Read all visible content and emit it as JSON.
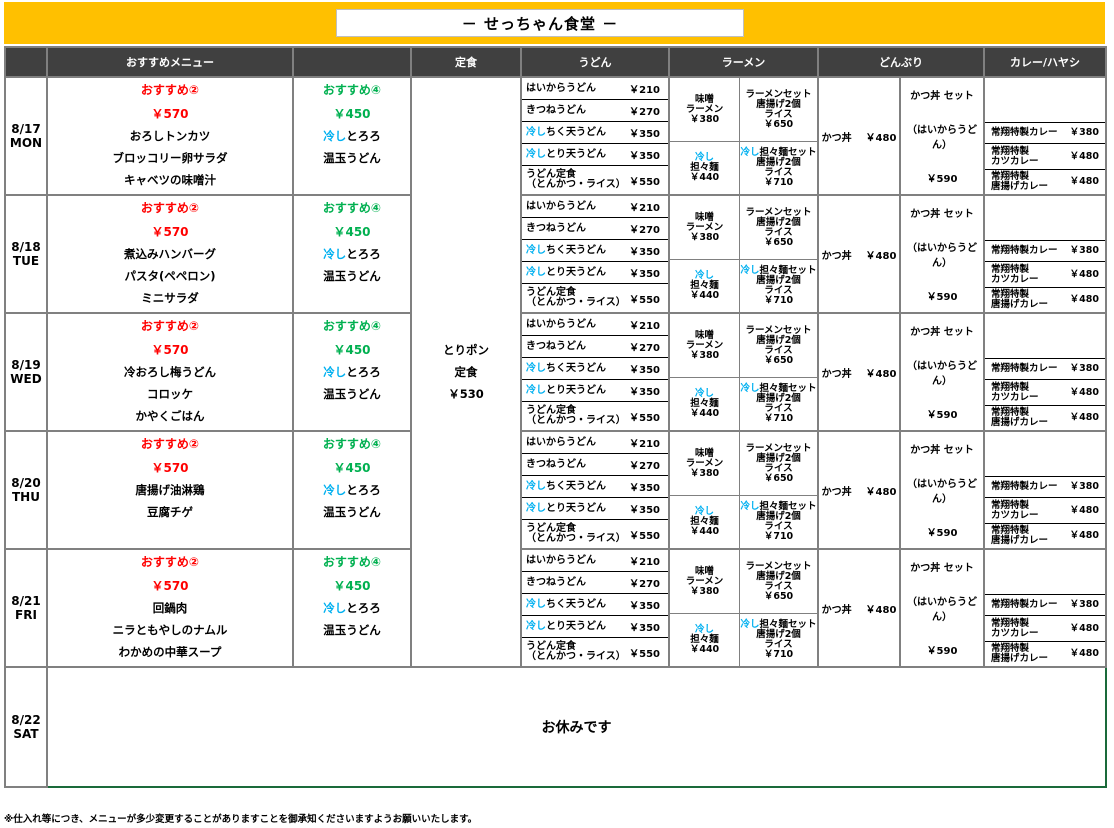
{
  "title": "－ せっちゃん食堂 －",
  "headers": {
    "recommend": "おすすめメニュー",
    "teishoku": "定食",
    "udon": "うどん",
    "ramen": "ラーメン",
    "donburi": "どんぶり",
    "curry": "カレー/ハヤシ"
  },
  "teishoku": {
    "name": "とりポン",
    "label": "定食",
    "price": "￥530"
  },
  "rec_label1": "おすすめ②",
  "rec_price1": "￥570",
  "rec_label2": "おすすめ④",
  "rec_price2": "￥450",
  "rec2_items_a": "冷し",
  "rec2_items_b": "とろろ",
  "rec2_items_c": "温玉うどん",
  "udon": [
    {
      "name": "はいからうどん",
      "price": "￥210"
    },
    {
      "name": "きつねうどん",
      "price": "￥270"
    },
    {
      "name_a": "冷し",
      "name_b": "ちく天うどん",
      "price": "￥350"
    },
    {
      "name_a": "冷し",
      "name_b": "とり天うどん",
      "price": "￥350"
    },
    {
      "name1": "うどん定食",
      "name2": "（とんかつ・ライス）",
      "price": "￥550"
    }
  ],
  "ramen": {
    "miso": [
      "味噌",
      "ラーメン",
      "￥380"
    ],
    "set": [
      "ラーメンセット",
      "唐揚げ2個",
      "ライス",
      "￥650"
    ],
    "tantan": [
      "冷し",
      "担々麺",
      "￥440"
    ],
    "tantanset_a": "冷し",
    "tantanset_b": "担々麺セット",
    "tantanset": [
      "唐揚げ2個",
      "ライス",
      "￥710"
    ]
  },
  "donburi": {
    "katsudon": "かつ丼",
    "katsudon_price": "￥480",
    "set": "かつ丼 セット",
    "set_sub": "（はいからうどん）",
    "set_price": "￥590"
  },
  "curry": [
    {
      "name": "常翔特製カレー",
      "price": "￥380"
    },
    {
      "name1": "常翔特製",
      "name2": "カツカレー",
      "price": "￥480"
    },
    {
      "name1": "常翔特製",
      "name2": "唐揚げカレー",
      "price": "￥480"
    }
  ],
  "days": [
    {
      "date": "8/17",
      "dow": "MON",
      "items": [
        "おろしトンカツ",
        "ブロッコリー卵サラダ",
        "キャベツの味噌汁"
      ]
    },
    {
      "date": "8/18",
      "dow": "TUE",
      "items": [
        "煮込みハンバーグ",
        "パスタ(ペペロン)",
        "ミニサラダ"
      ]
    },
    {
      "date": "8/19",
      "dow": "WED",
      "items": [
        "冷おろし梅うどん",
        "コロッケ",
        "かやくごはん"
      ]
    },
    {
      "date": "8/20",
      "dow": "THU",
      "items": [
        "唐揚げ油淋鶏",
        "豆腐チゲ"
      ]
    },
    {
      "date": "8/21",
      "dow": "FRI",
      "items": [
        "回鍋肉",
        "ニラともやしのナムル",
        "わかめの中華スープ"
      ]
    }
  ],
  "closed_day": {
    "date": "8/22",
    "dow": "SAT",
    "text": "お休みです"
  },
  "note": "※仕入れ等につき、メニューが多少変更することがありますことを御承知くださいますようお願いいたします。"
}
